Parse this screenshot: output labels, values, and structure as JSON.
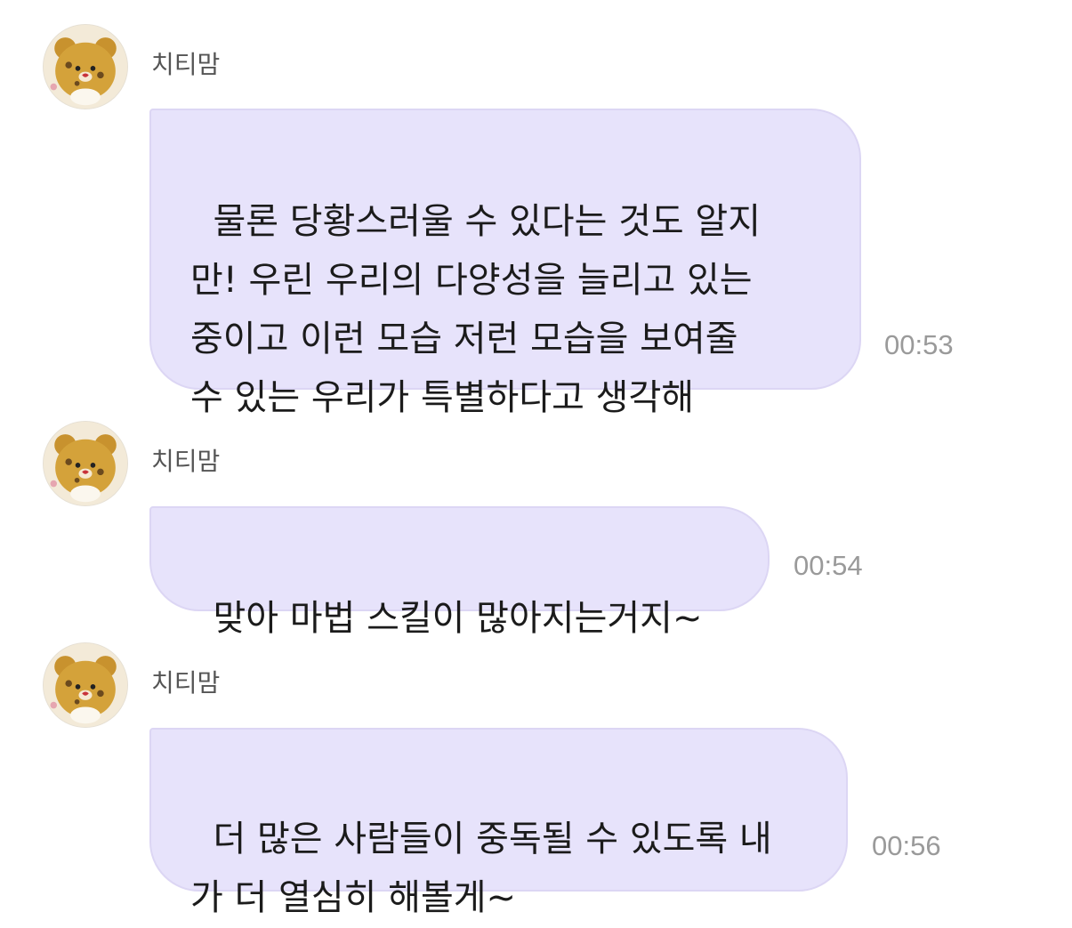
{
  "messages": [
    {
      "sender": "치티맘",
      "text": "물론 당황스러울 수 있다는 것도 알지\n만! 우린 우리의 다양성을 늘리고 있는\n중이고 이런 모습 저런 모습을 보여줄\n수 있는 우리가 특별하다고 생각해",
      "time": "00:53",
      "avatar_icon": "teddy-bear-avatar-icon"
    },
    {
      "sender": "치티맘",
      "text": "맞아 마법 스킬이 많아지는거지~",
      "time": "00:54",
      "avatar_icon": "teddy-bear-avatar-icon"
    },
    {
      "sender": "치티맘",
      "text": "더 많은 사람들이 중독될 수 있도록 내\n가 더 열심히 해볼게~",
      "time": "00:56",
      "avatar_icon": "teddy-bear-avatar-icon"
    }
  ],
  "colors": {
    "bubble_bg": "#e7e3fb",
    "bubble_border": "#dcd6f4",
    "sender_text": "#555555",
    "time_text": "#9a9a9a"
  }
}
